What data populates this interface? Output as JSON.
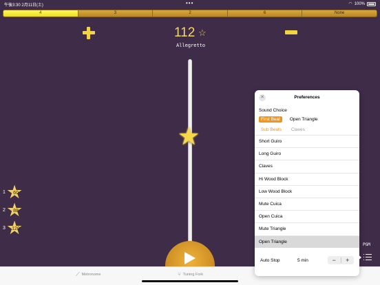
{
  "status": {
    "time": "午後3:30",
    "date": "2月11日(土)",
    "battery": "100%"
  },
  "beats": [
    {
      "label": "4",
      "active": true
    },
    {
      "label": "3",
      "active": false
    },
    {
      "label": "2",
      "active": false
    },
    {
      "label": "6",
      "active": false
    },
    {
      "label": "None",
      "active": false
    }
  ],
  "tempo": {
    "bpm": "112",
    "name": "Allegretto",
    "slider_fraction": 0.33
  },
  "presets": [
    {
      "index": "1",
      "value": "60"
    },
    {
      "index": "2",
      "value": "88"
    },
    {
      "index": "3",
      "value": "120"
    }
  ],
  "pgm_label": "PGM",
  "tabs": {
    "metronome": "Metronome",
    "tuning_fork": "Tuning Fork"
  },
  "preferences": {
    "title": "Preferences",
    "sound_choice_label": "Sound Choice",
    "first_beat": "First Beat",
    "first_beat_sound": "Open Triangle",
    "sub_beats": "Sub Beats",
    "sub_beats_sound": "Claves",
    "options": [
      "Short Guiro",
      "Long Guiro",
      "Claves",
      "Hi Wood Block",
      "Low Wood Block",
      "Mute Cuica",
      "Open Cuica",
      "Mute Triangle",
      "Open Triangle"
    ],
    "selected_option": "Open Triangle",
    "auto_stop_label": "Auto Stop",
    "auto_stop_value": "5 min"
  },
  "colors": {
    "accent": "#f0951e",
    "background": "#3e2c48",
    "gold": "#f4d341"
  }
}
